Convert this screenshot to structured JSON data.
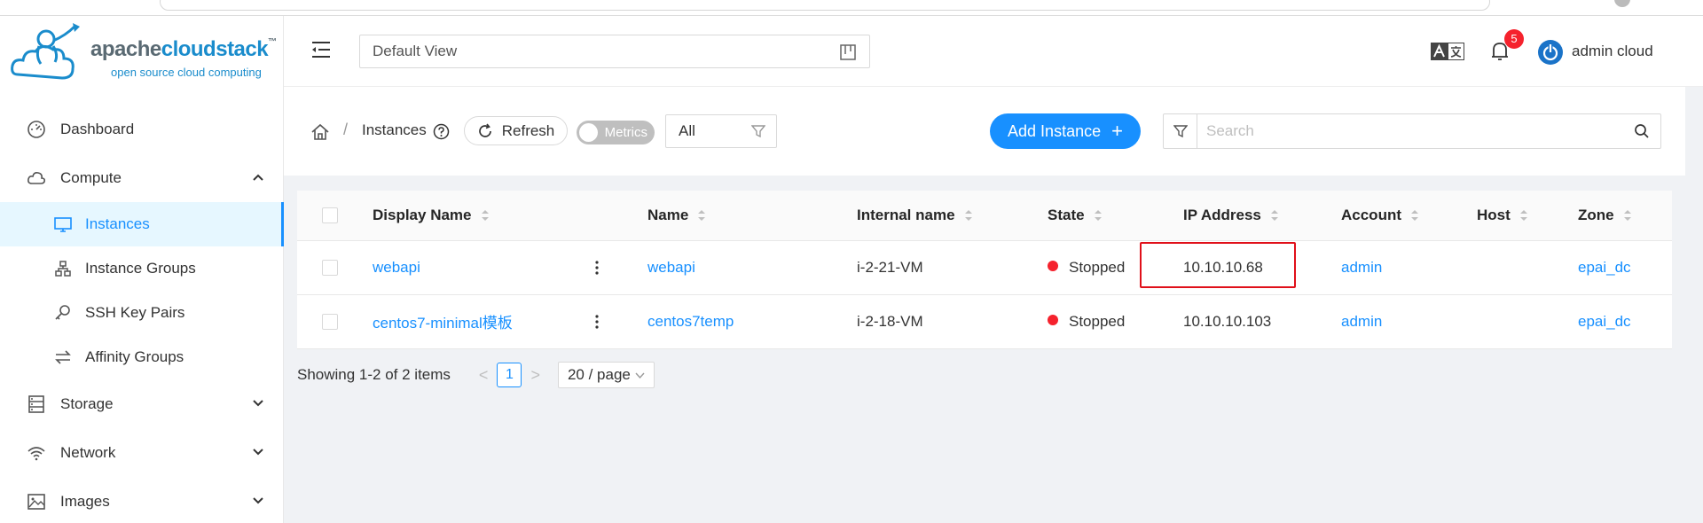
{
  "app": {
    "brand_part1": "apache",
    "brand_part2": "cloudstack",
    "tagline": "open source cloud computing",
    "trademark": "™"
  },
  "colors": {
    "primary": "#1890ff",
    "stopped": "#f5222d",
    "highlight": "#e0101a",
    "active_bg": "#e6f7ff"
  },
  "header": {
    "view_value": "Default View",
    "notification_count": "5",
    "user_name": "admin cloud"
  },
  "sidebar": {
    "items": [
      {
        "label": "Dashboard",
        "icon": "dashboard-icon"
      },
      {
        "label": "Compute",
        "icon": "cloud-icon",
        "expanded": true,
        "children": [
          {
            "label": "Instances",
            "icon": "desktop-icon",
            "active": true
          },
          {
            "label": "Instance Groups",
            "icon": "cluster-icon"
          },
          {
            "label": "SSH Key Pairs",
            "icon": "key-icon"
          },
          {
            "label": "Affinity Groups",
            "icon": "swap-icon"
          }
        ]
      },
      {
        "label": "Storage",
        "icon": "database-icon"
      },
      {
        "label": "Network",
        "icon": "wifi-icon"
      },
      {
        "label": "Images",
        "icon": "picture-icon"
      }
    ]
  },
  "toolbar": {
    "breadcrumb": "Instances",
    "separator": "/",
    "refresh_label": "Refresh",
    "metrics_label": "Metrics",
    "filter_value": "All",
    "add_label": "Add Instance",
    "add_plus": "+",
    "search_placeholder": "Search"
  },
  "table": {
    "columns": [
      "Display Name",
      "Name",
      "Internal name",
      "State",
      "IP Address",
      "Account",
      "Host",
      "Zone"
    ],
    "rows": [
      {
        "display_name": "webapi",
        "name": "webapi",
        "internal_name": "i-2-21-VM",
        "state": "Stopped",
        "ip": "10.10.10.68",
        "account": "admin",
        "host": "",
        "zone": "epai_dc"
      },
      {
        "display_name": "centos7-minimal模板",
        "name": "centos7temp",
        "internal_name": "i-2-18-VM",
        "state": "Stopped",
        "ip": "10.10.10.103",
        "account": "admin",
        "host": "",
        "zone": "epai_dc"
      }
    ]
  },
  "pagination": {
    "total_text": "Showing 1-2 of 2 items",
    "prev": "<",
    "current_page": "1",
    "next": ">",
    "page_size": "20 / page"
  }
}
